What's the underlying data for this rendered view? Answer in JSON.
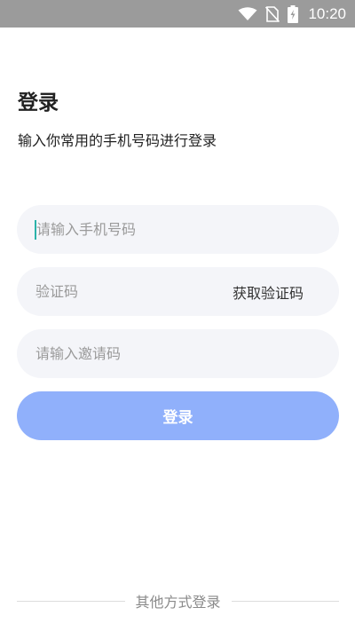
{
  "status_bar": {
    "time": "10:20",
    "icons": [
      "wifi-icon",
      "no-sim-icon",
      "battery-charging-icon"
    ]
  },
  "page": {
    "title": "登录",
    "subtitle": "输入你常用的手机号码进行登录"
  },
  "form": {
    "phone": {
      "placeholder": "请输入手机号码",
      "value": ""
    },
    "code": {
      "placeholder": "验证码",
      "value": ""
    },
    "get_code_label": "获取验证码",
    "invite": {
      "placeholder": "请输入邀请码",
      "value": ""
    },
    "submit_label": "登录"
  },
  "footer": {
    "other_methods_label": "其他方式登录"
  },
  "colors": {
    "status_bar_bg": "#9b9b9b",
    "field_bg": "#f4f5f9",
    "button_bg": "#90b0fb",
    "caret": "#2bb3a9"
  }
}
